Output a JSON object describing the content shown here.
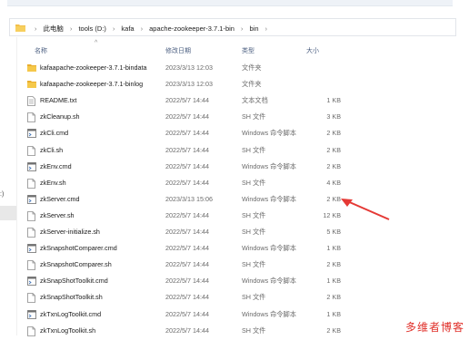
{
  "breadcrumb": {
    "items": [
      "此电脑",
      "tools (D:)",
      "kafa",
      "apache-zookeeper-3.7.1-bin",
      "bin"
    ]
  },
  "left_pane": {
    "partial_label": ":)"
  },
  "columns": {
    "name": "名称",
    "date": "修改日期",
    "type": "类型",
    "size": "大小"
  },
  "files": [
    {
      "name": "kafaapache-zookeeper-3.7.1-bindata",
      "date": "2023/3/13 12:03",
      "type": "文件夹",
      "size": "",
      "icon": "folder-icon"
    },
    {
      "name": "kafaapache-zookeeper-3.7.1-binlog",
      "date": "2023/3/13 12:03",
      "type": "文件夹",
      "size": "",
      "icon": "folder-icon"
    },
    {
      "name": "README.txt",
      "date": "2022/5/7 14:44",
      "type": "文本文档",
      "size": "1 KB",
      "icon": "text-file-icon"
    },
    {
      "name": "zkCleanup.sh",
      "date": "2022/5/7 14:44",
      "type": "SH 文件",
      "size": "3 KB",
      "icon": "file-icon"
    },
    {
      "name": "zkCli.cmd",
      "date": "2022/5/7 14:44",
      "type": "Windows 命令脚本",
      "size": "2 KB",
      "icon": "cmd-file-icon"
    },
    {
      "name": "zkCli.sh",
      "date": "2022/5/7 14:44",
      "type": "SH 文件",
      "size": "2 KB",
      "icon": "file-icon"
    },
    {
      "name": "zkEnv.cmd",
      "date": "2022/5/7 14:44",
      "type": "Windows 命令脚本",
      "size": "2 KB",
      "icon": "cmd-file-icon"
    },
    {
      "name": "zkEnv.sh",
      "date": "2022/5/7 14:44",
      "type": "SH 文件",
      "size": "4 KB",
      "icon": "file-icon"
    },
    {
      "name": "zkServer.cmd",
      "date": "2023/3/13 15:06",
      "type": "Windows 命令脚本",
      "size": "2 KB",
      "icon": "cmd-file-icon"
    },
    {
      "name": "zkServer.sh",
      "date": "2022/5/7 14:44",
      "type": "SH 文件",
      "size": "12 KB",
      "icon": "file-icon"
    },
    {
      "name": "zkServer-initialize.sh",
      "date": "2022/5/7 14:44",
      "type": "SH 文件",
      "size": "5 KB",
      "icon": "file-icon"
    },
    {
      "name": "zkSnapshotComparer.cmd",
      "date": "2022/5/7 14:44",
      "type": "Windows 命令脚本",
      "size": "1 KB",
      "icon": "cmd-file-icon"
    },
    {
      "name": "zkSnapshotComparer.sh",
      "date": "2022/5/7 14:44",
      "type": "SH 文件",
      "size": "2 KB",
      "icon": "file-icon"
    },
    {
      "name": "zkSnapShotToolkit.cmd",
      "date": "2022/5/7 14:44",
      "type": "Windows 命令脚本",
      "size": "1 KB",
      "icon": "cmd-file-icon"
    },
    {
      "name": "zkSnapShotToolkit.sh",
      "date": "2022/5/7 14:44",
      "type": "SH 文件",
      "size": "2 KB",
      "icon": "file-icon"
    },
    {
      "name": "zkTxnLogToolkit.cmd",
      "date": "2022/5/7 14:44",
      "type": "Windows 命令脚本",
      "size": "1 KB",
      "icon": "cmd-file-icon"
    },
    {
      "name": "zkTxnLogToolkit.sh",
      "date": "2022/5/7 14:44",
      "type": "SH 文件",
      "size": "2 KB",
      "icon": "file-icon"
    }
  ],
  "annotation": {
    "arrow_color": "#e53935",
    "points_to": "zkServer.cmd"
  },
  "watermark": {
    "text": "多维者博客",
    "color": "#e0302a"
  },
  "colors": {
    "folder": "#f3c04a",
    "header_text": "#4d6082"
  }
}
